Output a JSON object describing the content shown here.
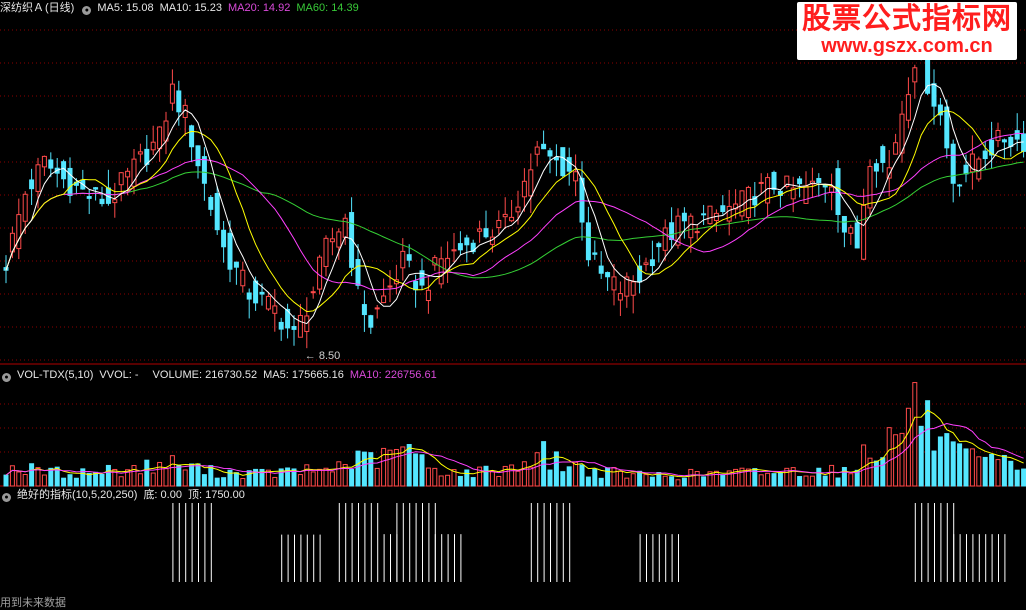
{
  "main_header": {
    "name": "深纺织Ａ",
    "period": "(日线)",
    "ma5": "MA5: 15.08",
    "ma10": "MA10: 15.23",
    "ma20": "MA20: 14.92",
    "ma60": "MA60: 14.39"
  },
  "vol_header": {
    "name": "VOL-TDX(5,10)",
    "vvol": "VVOL: -",
    "volume": "VOLUME: 216730.52",
    "ma5": "MA5: 175665.16",
    "ma10": "MA10: 226756.61"
  },
  "ind_header": {
    "name": "绝好的指标(10,5,20,250)",
    "bottom": "底: 0.00",
    "top": "顶: 1750.00"
  },
  "low_marker": "8.50",
  "footnote": "用到未来数据",
  "logo": {
    "line1": "股票公式指标网",
    "line2": "www.gszx.com.cn"
  },
  "colors": {
    "up": "#ff4a4a",
    "down": "#54e6ff",
    "ma5": "#ffffff",
    "ma10": "#ffff00",
    "ma20": "#ff40ff",
    "ma60": "#35d035",
    "grid": "#8b0000",
    "signal": "#ffffff"
  },
  "chart_data": [
    {
      "type": "candlestick",
      "title": "深纺织Ａ (日线)",
      "ylim": [
        8.0,
        20.5
      ],
      "candle_count": 160,
      "low_annotation": 8.5,
      "close_keypoints": [
        [
          0,
          11.6
        ],
        [
          3,
          14.1
        ],
        [
          6,
          15.2
        ],
        [
          9,
          14.6
        ],
        [
          13,
          14.0
        ],
        [
          16,
          13.8
        ],
        [
          20,
          15.0
        ],
        [
          24,
          16.1
        ],
        [
          26,
          17.8
        ],
        [
          28,
          16.9
        ],
        [
          31,
          14.4
        ],
        [
          34,
          12.1
        ],
        [
          38,
          10.5
        ],
        [
          42,
          9.9
        ],
        [
          45,
          8.9
        ],
        [
          48,
          10.6
        ],
        [
          50,
          12.1
        ],
        [
          53,
          13.2
        ],
        [
          55,
          10.4
        ],
        [
          57,
          9.4
        ],
        [
          59,
          10.3
        ],
        [
          62,
          11.6
        ],
        [
          65,
          10.6
        ],
        [
          68,
          11.7
        ],
        [
          71,
          12.1
        ],
        [
          74,
          12.6
        ],
        [
          78,
          12.9
        ],
        [
          81,
          14.5
        ],
        [
          83,
          15.6
        ],
        [
          86,
          15.2
        ],
        [
          89,
          14.8
        ],
        [
          91,
          11.9
        ],
        [
          93,
          11.1
        ],
        [
          96,
          10.6
        ],
        [
          99,
          11.1
        ],
        [
          102,
          12.3
        ],
        [
          105,
          12.9
        ],
        [
          108,
          13.1
        ],
        [
          111,
          13.3
        ],
        [
          114,
          13.6
        ],
        [
          117,
          14.1
        ],
        [
          120,
          14.4
        ],
        [
          123,
          14.2
        ],
        [
          126,
          14.3
        ],
        [
          129,
          14.6
        ],
        [
          131,
          12.8
        ],
        [
          133,
          12.2
        ],
        [
          135,
          15.5
        ],
        [
          138,
          15.0
        ],
        [
          140,
          17.1
        ],
        [
          142,
          19.0
        ],
        [
          144,
          18.1
        ],
        [
          146,
          16.9
        ],
        [
          148,
          14.6
        ],
        [
          150,
          14.9
        ],
        [
          153,
          15.6
        ],
        [
          156,
          16.1
        ],
        [
          159,
          16.0
        ]
      ],
      "moving_averages": [
        "MA5",
        "MA10",
        "MA20",
        "MA60"
      ]
    },
    {
      "type": "bar",
      "title": "VOL-TDX(5,10)",
      "ylim": [
        0,
        500000
      ],
      "volume_keypoints": [
        [
          0,
          90000
        ],
        [
          10,
          60000
        ],
        [
          20,
          85000
        ],
        [
          26,
          110000
        ],
        [
          32,
          70000
        ],
        [
          40,
          60000
        ],
        [
          50,
          80000
        ],
        [
          54,
          120000
        ],
        [
          60,
          140000
        ],
        [
          62,
          200000
        ],
        [
          66,
          90000
        ],
        [
          72,
          60000
        ],
        [
          80,
          95000
        ],
        [
          83,
          170000
        ],
        [
          86,
          120000
        ],
        [
          92,
          70000
        ],
        [
          100,
          50000
        ],
        [
          110,
          60000
        ],
        [
          120,
          70000
        ],
        [
          128,
          80000
        ],
        [
          132,
          60000
        ],
        [
          134,
          170000
        ],
        [
          138,
          220000
        ],
        [
          140,
          300000
        ],
        [
          142,
          420000
        ],
        [
          144,
          300000
        ],
        [
          146,
          200000
        ],
        [
          150,
          130000
        ],
        [
          155,
          110000
        ],
        [
          159,
          100000
        ]
      ],
      "series": [
        {
          "name": "MA5"
        },
        {
          "name": "MA10"
        }
      ]
    },
    {
      "type": "bar",
      "title": "绝好的指标(10,5,20,250)",
      "ylim": [
        0,
        1750
      ],
      "signal_value": 1750,
      "signal_groups": [
        {
          "start": 26,
          "end": 32,
          "level": 1750
        },
        {
          "start": 43,
          "end": 49,
          "level": 1050
        },
        {
          "start": 52,
          "end": 58,
          "level": 1750
        },
        {
          "start": 59,
          "end": 61,
          "level": 1060
        },
        {
          "start": 61,
          "end": 67,
          "level": 1750
        },
        {
          "start": 67,
          "end": 71,
          "level": 1060
        },
        {
          "start": 82,
          "end": 88,
          "level": 1750
        },
        {
          "start": 99,
          "end": 105,
          "level": 1060
        },
        {
          "start": 142,
          "end": 148,
          "level": 1750
        },
        {
          "start": 148,
          "end": 156,
          "level": 1060
        }
      ]
    }
  ]
}
